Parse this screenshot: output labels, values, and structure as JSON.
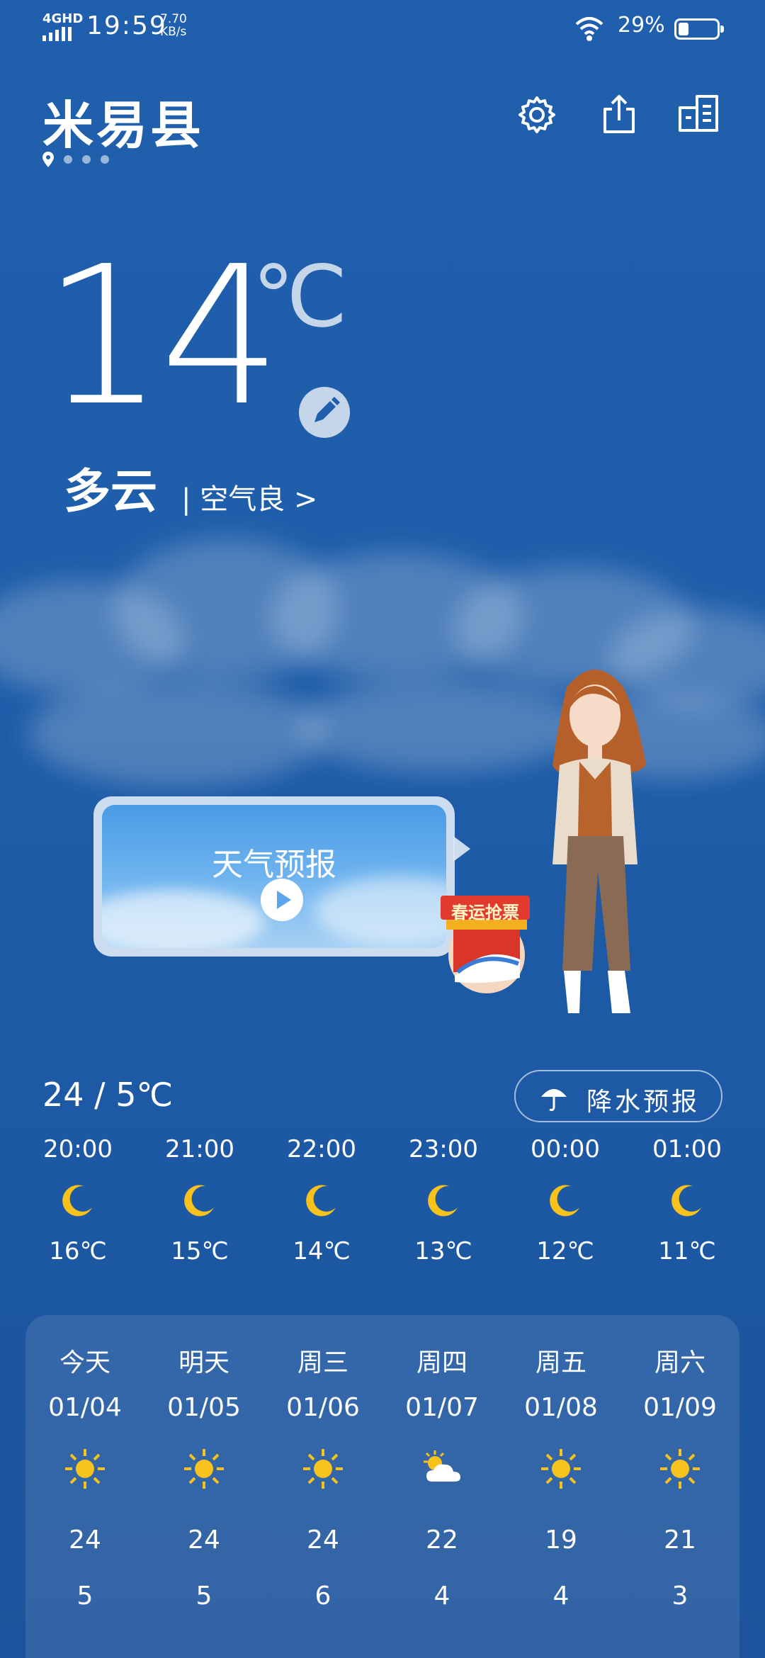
{
  "status": {
    "network": "4GHD",
    "time": "19:59",
    "speed_value": "7.70",
    "speed_unit": "KB/s",
    "battery": "29%"
  },
  "header": {
    "city": "米易县"
  },
  "current": {
    "temp": "14",
    "unit": "℃",
    "condition": "多云",
    "aqi": "| 空气良 >"
  },
  "video_card": {
    "title": "天气预报"
  },
  "promo": {
    "label": "春运抢票"
  },
  "hourly": {
    "range": "24 / 5℃",
    "rain_button": "降水预报",
    "items": [
      {
        "time": "20:00",
        "icon": "moon-icon",
        "temp": "16℃"
      },
      {
        "time": "21:00",
        "icon": "moon-icon",
        "temp": "15℃"
      },
      {
        "time": "22:00",
        "icon": "moon-icon",
        "temp": "14℃"
      },
      {
        "time": "23:00",
        "icon": "moon-icon",
        "temp": "13℃"
      },
      {
        "time": "00:00",
        "icon": "moon-icon",
        "temp": "12℃"
      },
      {
        "time": "01:00",
        "icon": "moon-icon",
        "temp": "11℃"
      }
    ]
  },
  "daily": [
    {
      "name": "今天",
      "date": "01/04",
      "icon": "sun-icon",
      "high": "24",
      "low": "5"
    },
    {
      "name": "明天",
      "date": "01/05",
      "icon": "sun-icon",
      "high": "24",
      "low": "5"
    },
    {
      "name": "周三",
      "date": "01/06",
      "icon": "sun-icon",
      "high": "24",
      "low": "6"
    },
    {
      "name": "周四",
      "date": "01/07",
      "icon": "partly-cloudy-icon",
      "high": "22",
      "low": "4"
    },
    {
      "name": "周五",
      "date": "01/08",
      "icon": "sun-icon",
      "high": "19",
      "low": "4"
    },
    {
      "name": "周六",
      "date": "01/09",
      "icon": "sun-icon",
      "high": "21",
      "low": "3"
    }
  ],
  "colors": {
    "background": "#1f5fad",
    "sun": "#f7c21b",
    "moon": "#f7c21b"
  }
}
